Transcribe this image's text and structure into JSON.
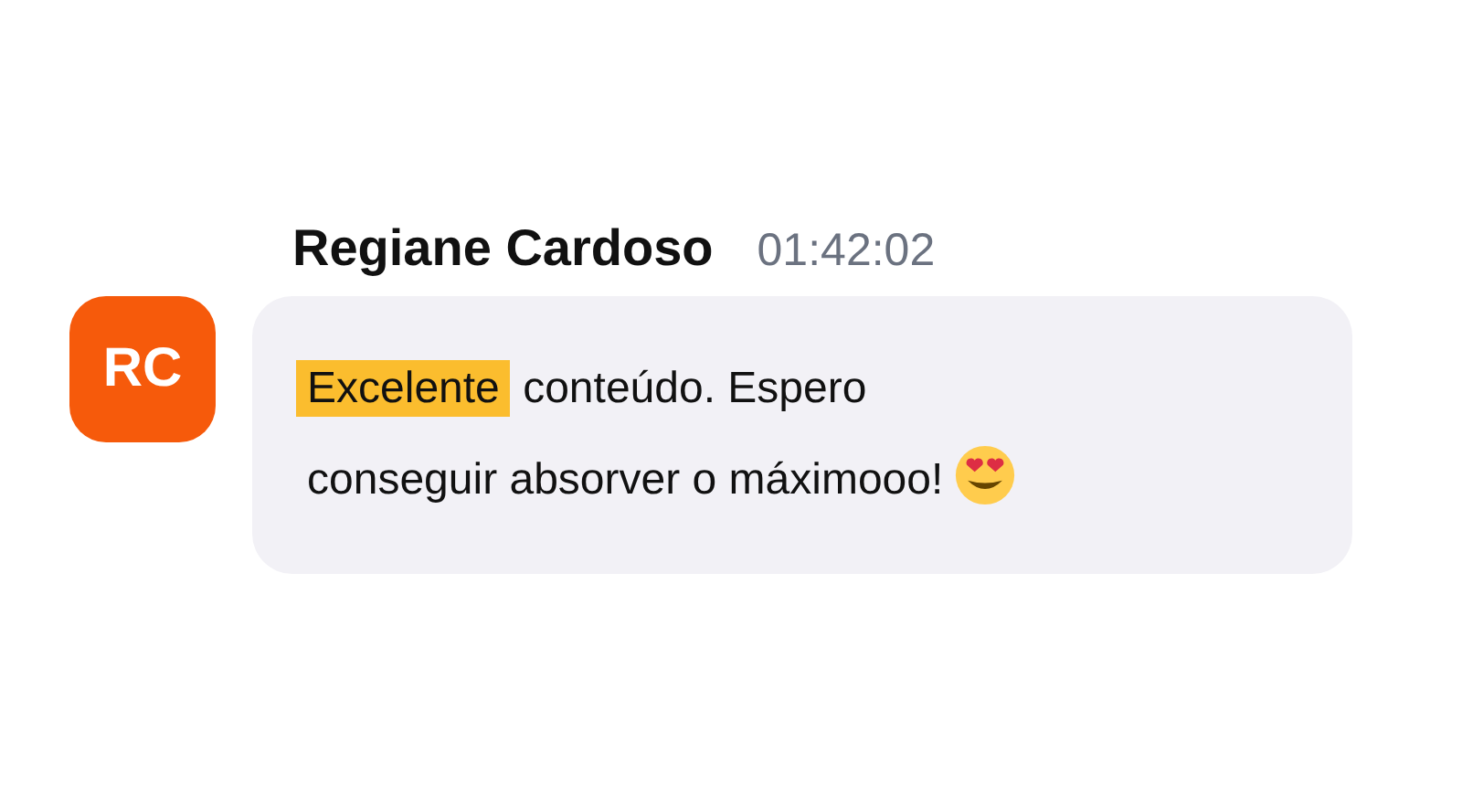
{
  "message": {
    "author": "Regiane Cardoso",
    "time": "01:42:02",
    "avatar": {
      "initials": "RC",
      "color": "#f65a0b"
    },
    "lines": [
      [
        {
          "text": "Excelente",
          "highlighted": true
        },
        {
          "text": " conteúdo. Espero",
          "highlighted": false
        }
      ],
      [
        {
          "text": "conseguir absorver o máximooo!",
          "highlighted": false
        }
      ]
    ]
  }
}
